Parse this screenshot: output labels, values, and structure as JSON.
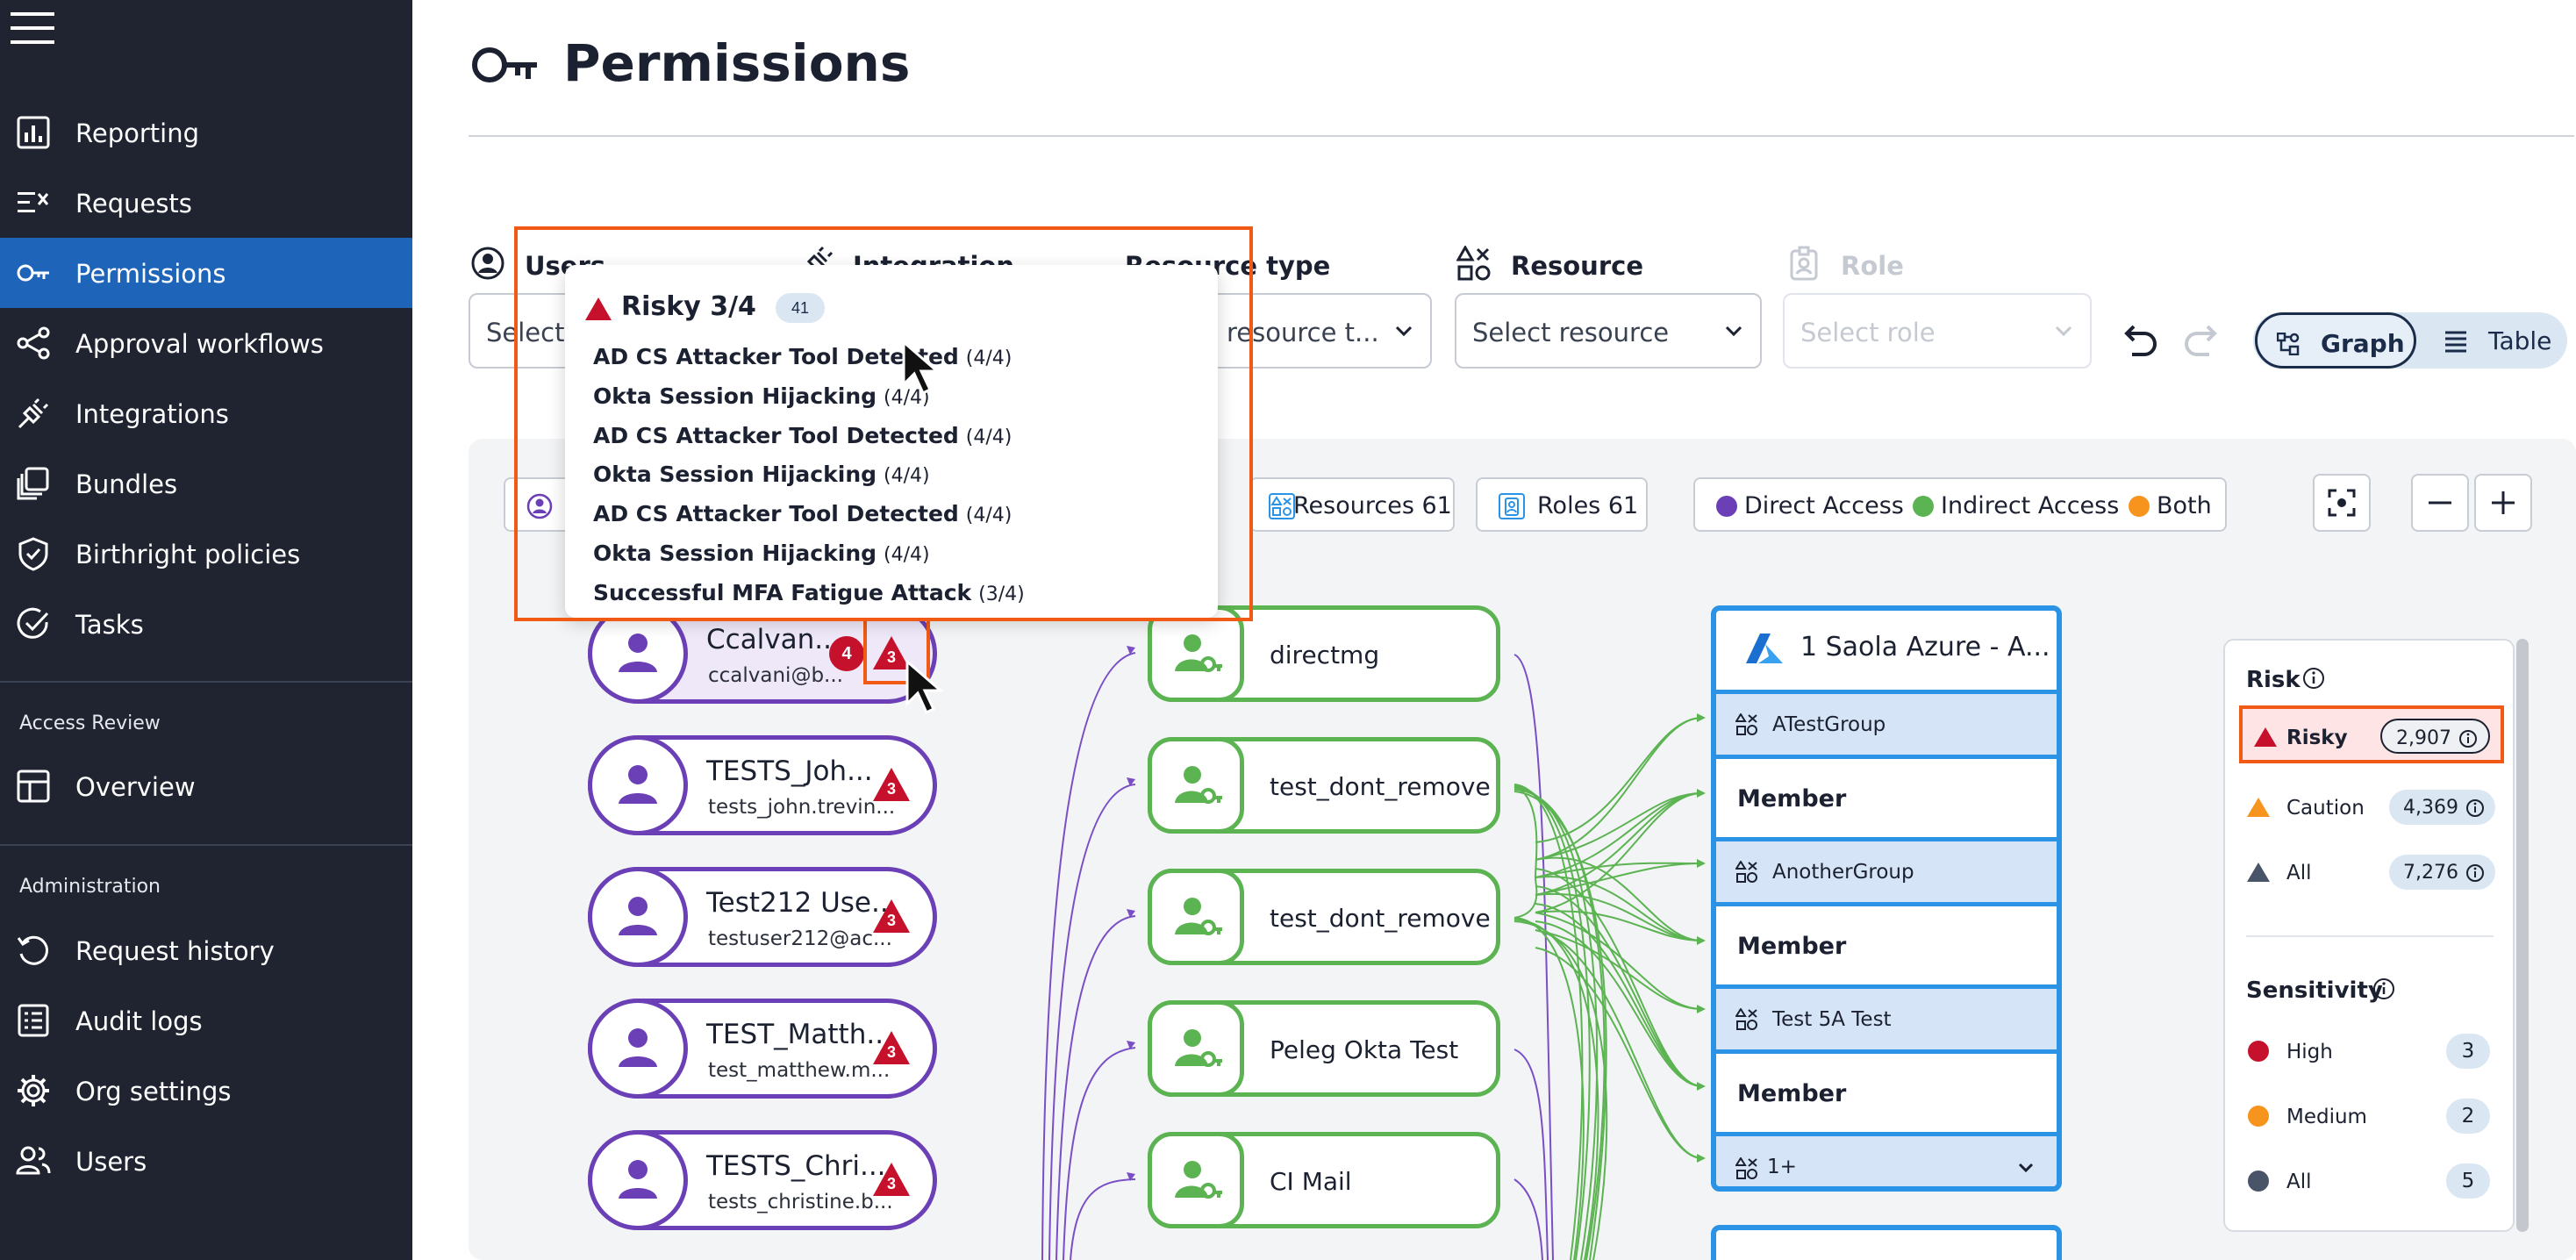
{
  "sidebar": {
    "items": [
      {
        "label": "Reporting",
        "icon": "reporting-icon"
      },
      {
        "label": "Requests",
        "icon": "requests-icon"
      },
      {
        "label": "Permissions",
        "icon": "key-icon",
        "active": true
      },
      {
        "label": "Approval workflows",
        "icon": "workflow-icon"
      },
      {
        "label": "Integrations",
        "icon": "plug-icon"
      },
      {
        "label": "Bundles",
        "icon": "bundles-icon"
      },
      {
        "label": "Birthright policies",
        "icon": "shield-check-icon"
      },
      {
        "label": "Tasks",
        "icon": "tasks-check-icon"
      }
    ],
    "access_review": {
      "title": "Access Review",
      "items": [
        {
          "label": "Overview",
          "icon": "overview-icon"
        }
      ]
    },
    "administration": {
      "title": "Administration",
      "items": [
        {
          "label": "Request history",
          "icon": "history-icon"
        },
        {
          "label": "Audit logs",
          "icon": "audit-log-icon"
        },
        {
          "label": "Org settings",
          "icon": "gear-icon"
        },
        {
          "label": "Users",
          "icon": "users-icon"
        }
      ]
    }
  },
  "header": {
    "title": "Permissions"
  },
  "filters": {
    "users": {
      "label": "Users",
      "value": "Select"
    },
    "integration": {
      "label": "Integration"
    },
    "resource_type": {
      "label": "Resource type",
      "value": "resource t..."
    },
    "resource": {
      "label": "Resource",
      "value": "Select resource"
    },
    "role": {
      "label": "Role",
      "value": "Select role",
      "disabled": true
    }
  },
  "view_toggle": {
    "graph": "Graph",
    "table": "Table",
    "selected": "Graph"
  },
  "graph_toolbar": {
    "resources_chip": "Resources 61",
    "roles_chip": "Roles 61",
    "legend": [
      {
        "label": "Direct Access",
        "color": "#6b3fb6"
      },
      {
        "label": "Indirect Access",
        "color": "#5cb352"
      },
      {
        "label": "Both",
        "color": "#f7941d"
      }
    ]
  },
  "users": [
    {
      "name": "Ccalvan...",
      "email": "ccalvani@b...",
      "risk_count": "3",
      "alert_count": "4"
    },
    {
      "name": "TESTS_Joh...",
      "email": "tests_john.trevin...",
      "risk_count": "3"
    },
    {
      "name": "Test212 Use...",
      "email": "testuser212@ac...",
      "risk_count": "3"
    },
    {
      "name": "TEST_Matth...",
      "email": "test_matthew.m...",
      "risk_count": "3"
    },
    {
      "name": "TESTS_Chri...",
      "email": "tests_christine.b...",
      "risk_count": "3"
    }
  ],
  "groups": [
    "directmg",
    "test_dont_remove",
    "test_dont_remove",
    "Peleg Okta Test",
    "CI Mail"
  ],
  "resource_card": {
    "title": "1 Saola Azure - A...",
    "rows": [
      {
        "group": "ATestGroup",
        "role": "Member"
      },
      {
        "group": "AnotherGroup",
        "role": "Member"
      },
      {
        "group": "Test 5A Test",
        "role": "Member"
      }
    ],
    "more": "1+"
  },
  "risk_panel": {
    "risk_title": "Risk",
    "risk_rows": [
      {
        "label": "Risky",
        "value": "2,907",
        "color": "#c6112c"
      },
      {
        "label": "Caution",
        "value": "4,369",
        "color": "#f7941d"
      },
      {
        "label": "All",
        "value": "7,276",
        "color": "#4a5468"
      }
    ],
    "sensitivity_title": "Sensitivity",
    "sensitivity_rows": [
      {
        "label": "High",
        "value": "3",
        "color": "#c6112c"
      },
      {
        "label": "Medium",
        "value": "2",
        "color": "#f7941d"
      },
      {
        "label": "All",
        "value": "5",
        "color": "#4a5468"
      }
    ]
  },
  "tooltip": {
    "title": "Risky 3/4",
    "count": "41",
    "items": [
      {
        "name": "AD CS Attacker Tool Detected",
        "score": "(4/4)"
      },
      {
        "name": "Okta Session Hijacking",
        "score": "(4/4)"
      },
      {
        "name": "AD CS Attacker Tool Detected",
        "score": "(4/4)"
      },
      {
        "name": "Okta Session Hijacking",
        "score": "(4/4)"
      },
      {
        "name": "AD CS Attacker Tool Detected",
        "score": "(4/4)"
      },
      {
        "name": "Okta Session Hijacking",
        "score": "(4/4)"
      },
      {
        "name": "Successful MFA Fatigue Attack",
        "score": "(3/4)"
      }
    ]
  }
}
